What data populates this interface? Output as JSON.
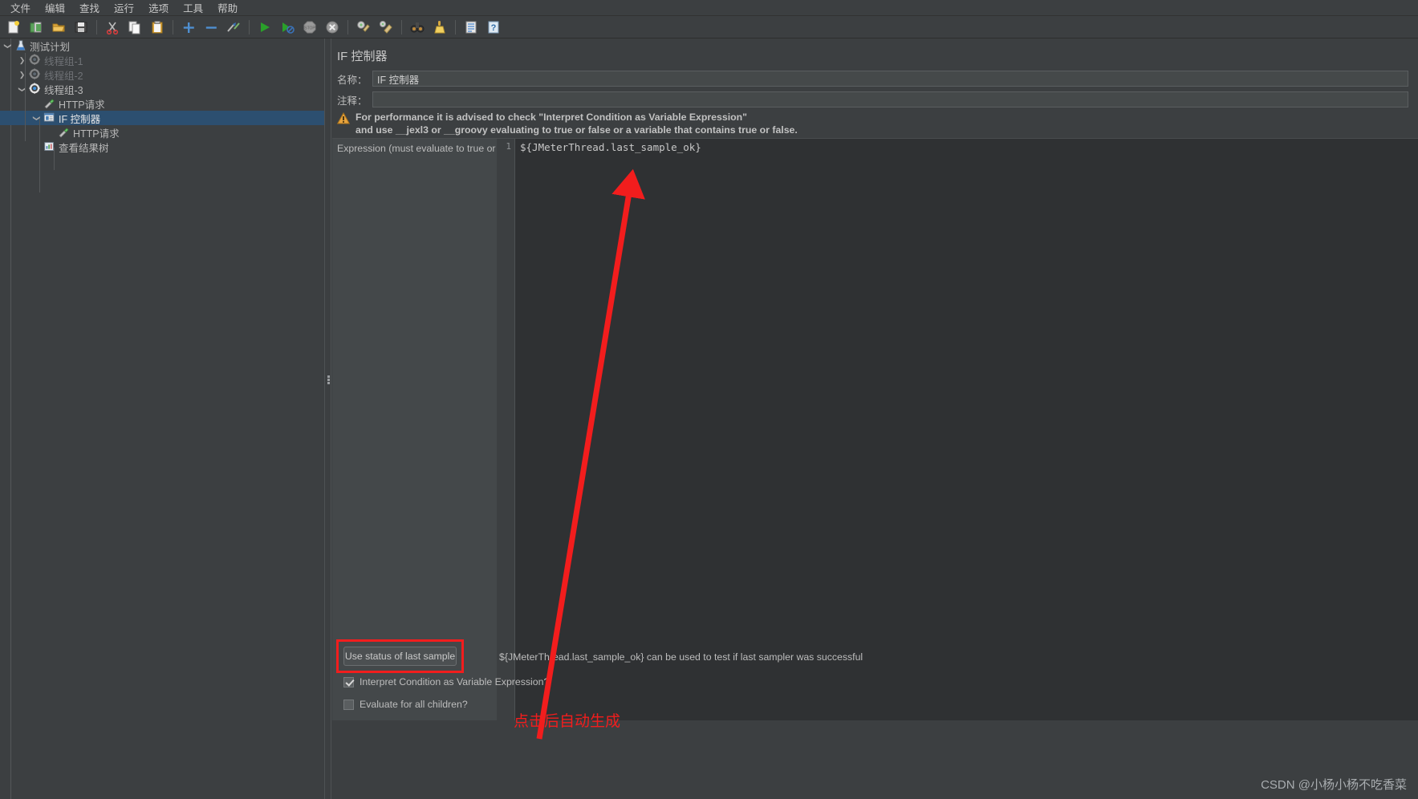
{
  "menu": {
    "items": [
      {
        "label": "文件",
        "name": "menu-file"
      },
      {
        "label": "编辑",
        "name": "menu-edit"
      },
      {
        "label": "查找",
        "name": "menu-search"
      },
      {
        "label": "运行",
        "name": "menu-run"
      },
      {
        "label": "选项",
        "name": "menu-options"
      },
      {
        "label": "工具",
        "name": "menu-tools"
      },
      {
        "label": "帮助",
        "name": "menu-help"
      }
    ]
  },
  "toolbar": {
    "buttons": [
      {
        "icon": "new-document-icon",
        "group": 1
      },
      {
        "icon": "open-template-icon",
        "group": 1
      },
      {
        "icon": "open-folder-icon",
        "group": 1
      },
      {
        "icon": "save-floppy-icon",
        "group": 1
      },
      {
        "icon": "cut-scissors-icon",
        "group": 2
      },
      {
        "icon": "copy-icon",
        "group": 2
      },
      {
        "icon": "paste-clipboard-icon",
        "group": 2
      },
      {
        "icon": "expand-plus-icon",
        "group": 3
      },
      {
        "icon": "collapse-minus-icon",
        "group": 3
      },
      {
        "icon": "toggle-enable-icon",
        "group": 3
      },
      {
        "icon": "start-play-icon",
        "group": 4
      },
      {
        "icon": "start-no-pauses-icon",
        "group": 4
      },
      {
        "icon": "stop-icon",
        "group": 4
      },
      {
        "icon": "shutdown-icon",
        "group": 4
      },
      {
        "icon": "clear-icon",
        "group": 5
      },
      {
        "icon": "clear-all-icon",
        "group": 5
      },
      {
        "icon": "search-binoculars-icon",
        "group": 6
      },
      {
        "icon": "reset-search-broom-icon",
        "group": 6
      },
      {
        "icon": "function-helper-icon",
        "group": 7
      },
      {
        "icon": "help-icon",
        "group": 7
      }
    ]
  },
  "tree": {
    "nodes": [
      {
        "label": "测试计划",
        "icon": "test-plan-icon",
        "indent": 0,
        "twisty": "expanded",
        "state": "normal",
        "selected": false
      },
      {
        "label": "线程组-1",
        "icon": "thread-group-icon",
        "indent": 1,
        "twisty": "collapsed",
        "state": "disabled",
        "selected": false
      },
      {
        "label": "线程组-2",
        "icon": "thread-group-icon",
        "indent": 1,
        "twisty": "collapsed",
        "state": "disabled",
        "selected": false
      },
      {
        "label": "线程组-3",
        "icon": "thread-group-icon",
        "indent": 1,
        "twisty": "expanded",
        "state": "normal",
        "selected": false
      },
      {
        "label": "HTTP请求",
        "icon": "http-sampler-icon",
        "indent": 2,
        "twisty": "none",
        "state": "normal",
        "selected": false
      },
      {
        "label": "IF 控制器",
        "icon": "if-controller-icon",
        "indent": 2,
        "twisty": "expanded",
        "state": "normal",
        "selected": true
      },
      {
        "label": "HTTP请求",
        "icon": "http-sampler-icon",
        "indent": 3,
        "twisty": "none",
        "state": "normal",
        "selected": false
      },
      {
        "label": "查看结果树",
        "icon": "view-results-tree-icon",
        "indent": 2,
        "twisty": "none",
        "state": "normal",
        "selected": false
      }
    ]
  },
  "panel": {
    "title": "IF 控制器",
    "name_label": "名称：",
    "name_value": "IF 控制器",
    "comment_label": "注释：",
    "comment_value": "",
    "warning_line1": "For performance it is advised to check \"Interpret Condition as Variable Expression\"",
    "warning_line2": "and use __jexl3 or __groovy evaluating to true or false or a variable that contains true or false.",
    "warning_icon": "warning-triangle-icon",
    "expression_label": "Expression (must evaluate to true or false)",
    "line_number": "1",
    "expression_value": "${JMeterThread.last_sample_ok}",
    "use_last_sample_button": "Use status of last sample",
    "hint_text": "${JMeterThread.last_sample_ok} can be used to test if last sampler was successful",
    "checkbox_interpret": "Interpret Condition as Variable Expression?",
    "checkbox_interpret_checked": true,
    "checkbox_evaluate_all": "Evaluate for all children?",
    "checkbox_evaluate_all_checked": false
  },
  "annotation": {
    "caption": "点击后自动生成",
    "color": "#f21d1d"
  },
  "watermark": {
    "text": "CSDN @小杨小杨不吃香菜"
  },
  "colors": {
    "background": "#3c3f41",
    "selection": "#2c4f70",
    "editor_background": "#2f3133",
    "accent_red": "#f21d1d",
    "warning_orange": "#e8a33d"
  }
}
